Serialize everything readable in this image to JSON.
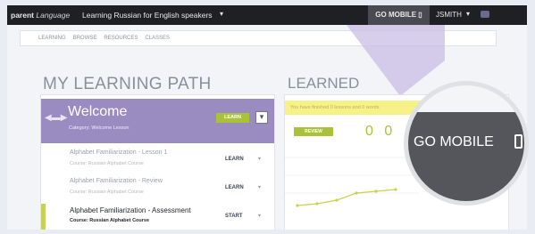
{
  "topbar": {
    "brand_bold": "parent",
    "brand_italic": "Language",
    "course": "Learning Russian for English speakers",
    "go_mobile": "GO MOBILE",
    "user": "JSMITH"
  },
  "subnav": {
    "items": [
      "LEARNING",
      "BROWSE",
      "RESOURCES",
      "CLASSES"
    ]
  },
  "learning_path": {
    "title": "MY LEARNING PATH",
    "welcome": {
      "title": "Welcome",
      "subtitle": "Category: Welcome Lesson",
      "badge": "LEARN"
    },
    "rows": [
      {
        "title": "Alphabet Familiarization - Lesson 1",
        "course": "Course: Russian Alphabet Course",
        "action": "LEARN"
      },
      {
        "title": "Alphabet Familiarization - Review",
        "course": "Course: Russian Alphabet Course",
        "action": "LEARN"
      },
      {
        "title": "Alphabet Familiarization - Assessment",
        "course": "Course: Russian Alphabet Course",
        "action": "START"
      }
    ]
  },
  "learned": {
    "title": "LEARNED",
    "banner": "You have finished 0 lessons and 0 words",
    "pill": "REVIEW",
    "counter": "0 0"
  },
  "magnifier": {
    "label": "GO MOBILE"
  },
  "colors": {
    "accent_green": "#a9c23a",
    "welcome_purple": "#9a8cc0",
    "topbar": "#1f2023"
  }
}
